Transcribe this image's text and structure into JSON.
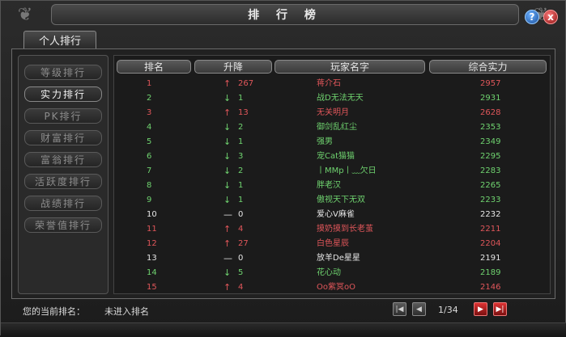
{
  "window": {
    "title": "排 行 榜",
    "help": "?",
    "close": "x"
  },
  "tabs": [
    {
      "label": "个人排行"
    }
  ],
  "side_menu": [
    {
      "label": "等级排行",
      "active": false
    },
    {
      "label": "实力排行",
      "active": true
    },
    {
      "label": "PK排行",
      "active": false
    },
    {
      "label": "财富排行",
      "active": false
    },
    {
      "label": "富翁排行",
      "active": false
    },
    {
      "label": "活跃度排行",
      "active": false
    },
    {
      "label": "战绩排行",
      "active": false
    },
    {
      "label": "荣誉值排行",
      "active": false
    }
  ],
  "table": {
    "columns": [
      "排名",
      "升降",
      "玩家名字",
      "综合实力"
    ],
    "rows": [
      {
        "rank": "1",
        "trend": "up",
        "arrow": "↑",
        "change": "267",
        "name": "蒋介石",
        "power": "2957"
      },
      {
        "rank": "2",
        "trend": "down",
        "arrow": "↓",
        "change": "1",
        "name": "战D无法无天",
        "power": "2931"
      },
      {
        "rank": "3",
        "trend": "up",
        "arrow": "↑",
        "change": "13",
        "name": "无关明月",
        "power": "2628"
      },
      {
        "rank": "4",
        "trend": "down",
        "arrow": "↓",
        "change": "2",
        "name": "御剑乱红尘",
        "power": "2353"
      },
      {
        "rank": "5",
        "trend": "down",
        "arrow": "↓",
        "change": "1",
        "name": "强男",
        "power": "2349"
      },
      {
        "rank": "6",
        "trend": "down",
        "arrow": "↓",
        "change": "3",
        "name": "宠Cat猫猫",
        "power": "2295"
      },
      {
        "rank": "7",
        "trend": "down",
        "arrow": "↓",
        "change": "2",
        "name": "丨MMp丨﹏欠日",
        "power": "2283"
      },
      {
        "rank": "8",
        "trend": "down",
        "arrow": "↓",
        "change": "1",
        "name": "胖老汉",
        "power": "2265"
      },
      {
        "rank": "9",
        "trend": "down",
        "arrow": "↓",
        "change": "1",
        "name": "傲视天下无双",
        "power": "2233"
      },
      {
        "rank": "10",
        "trend": "same",
        "arrow": "—",
        "change": "0",
        "name": "爱心V麻雀",
        "power": "2232"
      },
      {
        "rank": "11",
        "trend": "up",
        "arrow": "↑",
        "change": "4",
        "name": "摸奶摸到长老茧",
        "power": "2211"
      },
      {
        "rank": "12",
        "trend": "up",
        "arrow": "↑",
        "change": "27",
        "name": "白色星辰",
        "power": "2204"
      },
      {
        "rank": "13",
        "trend": "same",
        "arrow": "—",
        "change": "0",
        "name": "放羊De星星",
        "power": "2191"
      },
      {
        "rank": "14",
        "trend": "down",
        "arrow": "↓",
        "change": "5",
        "name": "花心动",
        "power": "2189"
      },
      {
        "rank": "15",
        "trend": "up",
        "arrow": "↑",
        "change": "4",
        "name": "Oo紫冥oO",
        "power": "2146"
      }
    ]
  },
  "footer": {
    "current_rank_label": "您的当前排名：",
    "current_rank_value": "未进入排名",
    "page_indicator": "1/34"
  },
  "pager_icons": {
    "first": "|◀",
    "prev": "◀",
    "next": "▶",
    "last": "▶|"
  },
  "colors": {
    "up": "#e0565a",
    "down": "#6fd36f",
    "same": "#e6e6e6"
  }
}
